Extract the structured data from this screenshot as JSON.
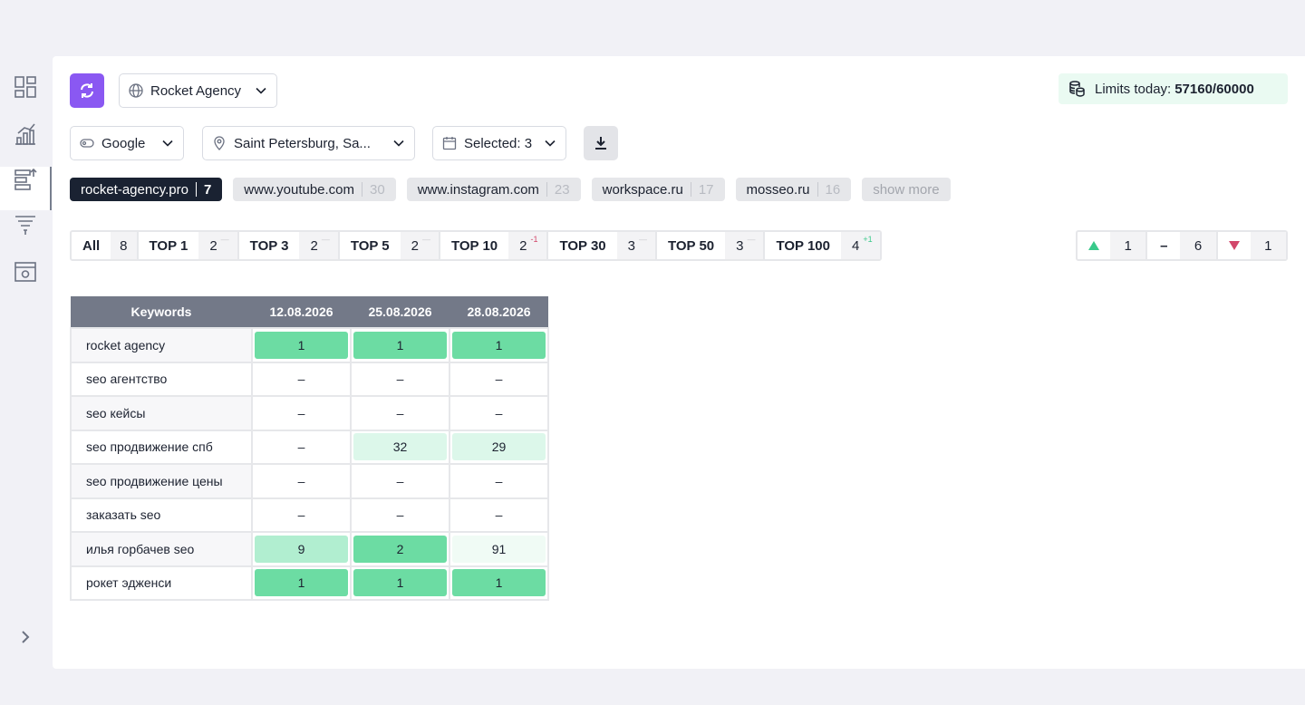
{
  "project": {
    "name": "Rocket Agency"
  },
  "limits": {
    "label": "Limits today:",
    "value": "57160/60000"
  },
  "filters": {
    "engine": "Google",
    "location": "Saint Petersburg, Sa...",
    "dates": "Selected: 3"
  },
  "domains": [
    {
      "name": "rocket-agency.pro",
      "count": "7"
    },
    {
      "name": "www.youtube.com",
      "count": "30"
    },
    {
      "name": "www.instagram.com",
      "count": "23"
    },
    {
      "name": "workspace.ru",
      "count": "17"
    },
    {
      "name": "mosseo.ru",
      "count": "16"
    }
  ],
  "show_more": "show more",
  "tops": [
    {
      "label": "All",
      "value": "8",
      "delta": ""
    },
    {
      "label": "TOP 1",
      "value": "2",
      "delta": "—"
    },
    {
      "label": "TOP 3",
      "value": "2",
      "delta": "—"
    },
    {
      "label": "TOP 5",
      "value": "2",
      "delta": "—"
    },
    {
      "label": "TOP 10",
      "value": "2",
      "delta": "-1"
    },
    {
      "label": "TOP 30",
      "value": "3",
      "delta": "—"
    },
    {
      "label": "TOP 50",
      "value": "3",
      "delta": "—"
    },
    {
      "label": "TOP 100",
      "value": "4",
      "delta": "+1"
    }
  ],
  "trend": {
    "up": "1",
    "same_symbol": "–",
    "same": "6",
    "down": "1"
  },
  "table": {
    "headers": [
      "Keywords",
      "12.08.2026",
      "25.08.2026",
      "28.08.2026"
    ],
    "rows": [
      {
        "keyword": "rocket agency",
        "values": [
          "1",
          "1",
          "1"
        ]
      },
      {
        "keyword": "seo агентство",
        "values": [
          "–",
          "–",
          "–"
        ]
      },
      {
        "keyword": "seo кейсы",
        "values": [
          "–",
          "–",
          "–"
        ]
      },
      {
        "keyword": "seo продвижение спб",
        "values": [
          "–",
          "32",
          "29"
        ]
      },
      {
        "keyword": "seo продвижение цены",
        "values": [
          "–",
          "–",
          "–"
        ]
      },
      {
        "keyword": "заказать seo",
        "values": [
          "–",
          "–",
          "–"
        ]
      },
      {
        "keyword": "илья горбачев seo",
        "values": [
          "9",
          "2",
          "91"
        ]
      },
      {
        "keyword": "рокет эдженси",
        "values": [
          "1",
          "1",
          "1"
        ]
      }
    ]
  },
  "colors": {
    "accent": "#8a58f2",
    "header": "#737988",
    "top1": "#6cdca3",
    "top10": "#b1eed0",
    "top30": "#dcf7ea",
    "top100": "#f0fbf5",
    "up": "#39c98a",
    "down": "#d2476a"
  }
}
